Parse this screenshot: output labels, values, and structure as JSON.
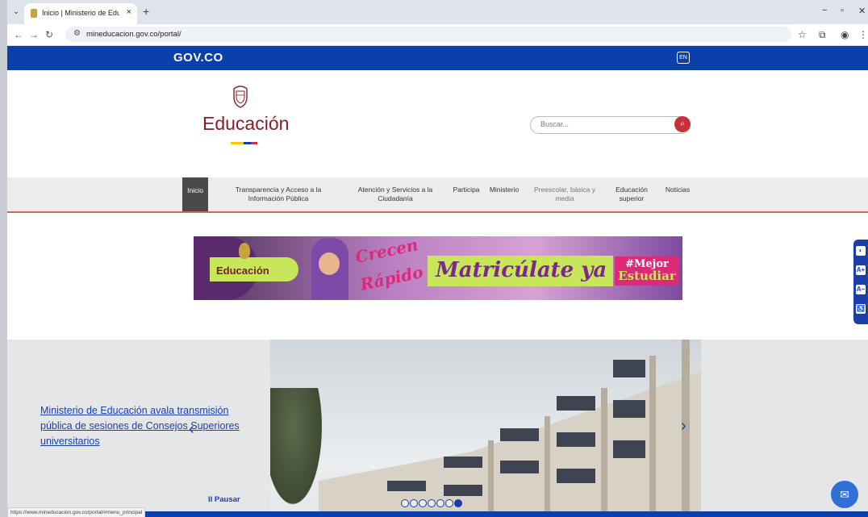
{
  "browser": {
    "tab_title": "Inicio | Ministerio de Educación",
    "tab_close": "×",
    "new_tab": "+",
    "url": "mineducacion.gov.co/portal/",
    "window_controls": {
      "minimize": "−",
      "restore": "▫",
      "close": "✕"
    }
  },
  "govbar": {
    "logo": "GOV.CO",
    "lang_button": "EN"
  },
  "header": {
    "brand": "Educación",
    "search_placeholder": "Buscar...",
    "flag_colors": [
      "#f7c600",
      "#0b3fab",
      "#c8303b"
    ]
  },
  "menu": {
    "items": [
      {
        "label": "Inicio"
      },
      {
        "label": "Transparencia y Acceso a la Información Pública"
      },
      {
        "label": "Atención y Servicios a la Ciudadanía"
      },
      {
        "label": "Participa"
      },
      {
        "label": "Ministerio"
      },
      {
        "label": "Preescolar, básica y media"
      },
      {
        "label": "Educación superior"
      },
      {
        "label": "Noticias"
      }
    ]
  },
  "banner": {
    "brand": "Educación",
    "crecen": "Crecen",
    "rapido": "Rápido",
    "headline": "Matricúlate ya",
    "hashtag_top": "#Mejor",
    "hashtag_bottom": "Estudiar"
  },
  "carousel": {
    "headline": "Ministerio de Educación avala transmisión pública de sesiones de Consejos Superiores universitarios",
    "pause_label": "II Pausar",
    "total_slides": 7,
    "active_slide": 7
  },
  "status_url": "https://www.mineducacion.gov.co/portal/#menu_principal",
  "accessibility": [
    "◐",
    "A+",
    "A−",
    "♿"
  ],
  "colors": {
    "gov_blue": "#0b3fab",
    "brand_red": "#8a1c2b",
    "link_blue": "#1a3fa8",
    "accent_red": "#c8303b"
  }
}
